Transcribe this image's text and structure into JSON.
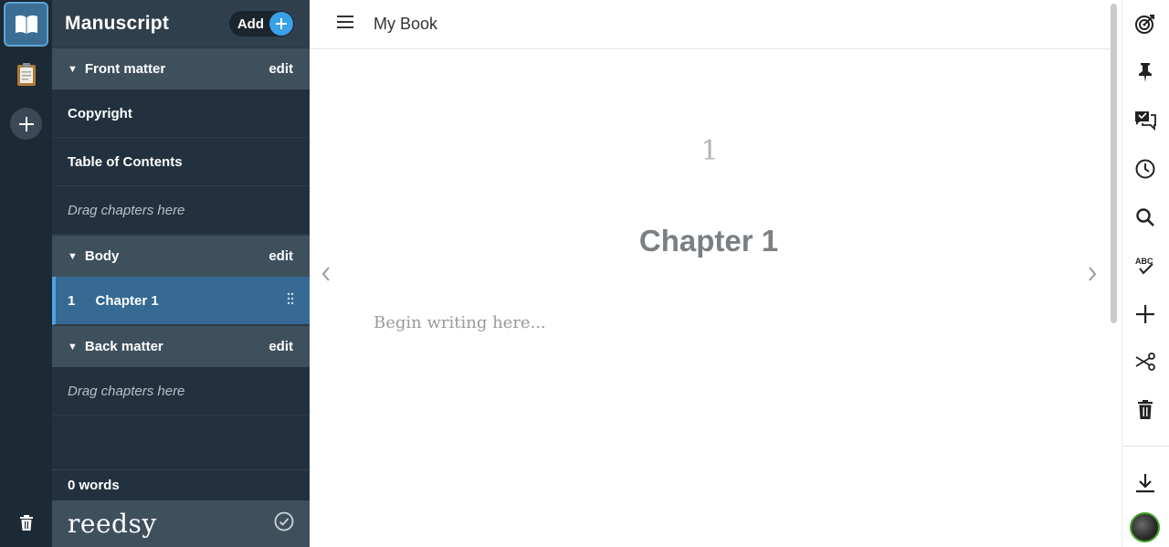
{
  "sidebar": {
    "title": "Manuscript",
    "add_label": "Add",
    "sections": [
      {
        "name": "Front matter",
        "edit": "edit",
        "items": [
          "Copyright",
          "Table of Contents"
        ],
        "drag_hint": "Drag chapters here"
      },
      {
        "name": "Body",
        "edit": "edit",
        "chapters": [
          {
            "number": "1",
            "title": "Chapter 1"
          }
        ]
      },
      {
        "name": "Back matter",
        "edit": "edit",
        "drag_hint": "Drag chapters here"
      }
    ],
    "word_count": "0 words",
    "brand": "reedsy"
  },
  "topbar": {
    "book_title": "My Book"
  },
  "editor": {
    "page_number": "1",
    "chapter_title": "Chapter 1",
    "placeholder": "Begin writing here..."
  },
  "right_toolbar": {
    "icons": [
      "goals-icon",
      "pin-icon",
      "comments-icon",
      "history-icon",
      "search-icon",
      "spellcheck-icon",
      "add-icon",
      "cut-icon",
      "trash-icon",
      "download-icon"
    ]
  },
  "colors": {
    "accent": "#3aa0e8",
    "sidebar_bg": "#22313d",
    "section_bg": "#3f505d",
    "active_bg": "#366993"
  }
}
